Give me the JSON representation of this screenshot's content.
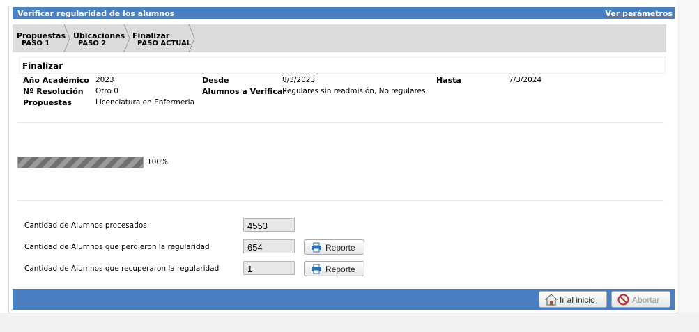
{
  "title": "Verificar regularidad de los alumnos",
  "params_link": "Ver parámetros",
  "steps": [
    {
      "name": "Propuestas",
      "sub": "PASO 1"
    },
    {
      "name": "Ubicaciones",
      "sub": "PASO 2"
    },
    {
      "name": "Finalizar",
      "sub": "PASO ACTUAL"
    }
  ],
  "section_title": "Finalizar",
  "info": {
    "anio_label": "Año Académico",
    "anio_value": "2023",
    "resolucion_label": "Nº Resolución",
    "resolucion_value": "Otro 0",
    "propuestas_label": "Propuestas",
    "propuestas_value": "Licenciatura en Enfermeria",
    "desde_label": "Desde",
    "desde_value": "8/3/2023",
    "alumnos_label": "Alumnos a Verificar",
    "alumnos_value": "Regulares sin readmisión, No regulares",
    "hasta_label": "Hasta",
    "hasta_value": "7/3/2024"
  },
  "progress": {
    "percent": 100,
    "text": "100%"
  },
  "results": [
    {
      "label": "Cantidad de Alumnos procesados",
      "value": "4553"
    },
    {
      "label": "Cantidad de Alumnos que perdieron la regularidad",
      "value": "654",
      "button": "Reporte"
    },
    {
      "label": "Cantidad de Alumnos que recuperaron la regularidad",
      "value": "1",
      "button": "Reporte"
    }
  ],
  "footer": {
    "inicio": "Ir al inicio",
    "abortar": "Abortar"
  },
  "colors": {
    "header": "#4a7fc1",
    "steps_bg": "#dcdcdc"
  },
  "icons": {
    "printer": "printer-icon",
    "home": "home-icon",
    "abort": "abort-icon"
  }
}
